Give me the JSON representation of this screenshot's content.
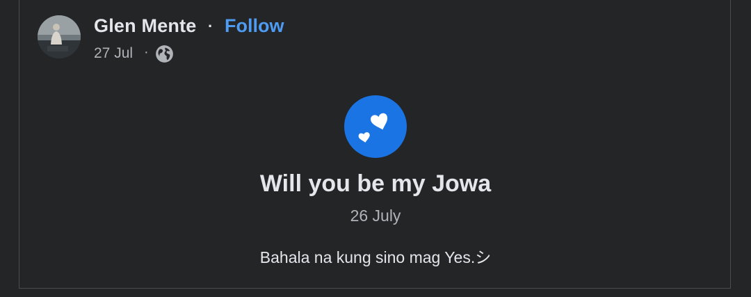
{
  "post": {
    "author_name": "Glen Mente",
    "separator": "·",
    "follow_label": "Follow",
    "date": "27 Jul",
    "date_separator": "·",
    "privacy_icon": "globe-icon",
    "avatar_icon": "profile-photo"
  },
  "event": {
    "icon": "hearts-icon",
    "title": "Will you be my Jowa",
    "date": "26 July",
    "description": "Bahala na kung sino mag Yes.シ"
  },
  "colors": {
    "background": "#242527",
    "text_primary": "#e4e6eb",
    "text_secondary": "#b0b3b8",
    "link": "#4d9bf2",
    "event_icon_bg": "#1b74e4"
  }
}
